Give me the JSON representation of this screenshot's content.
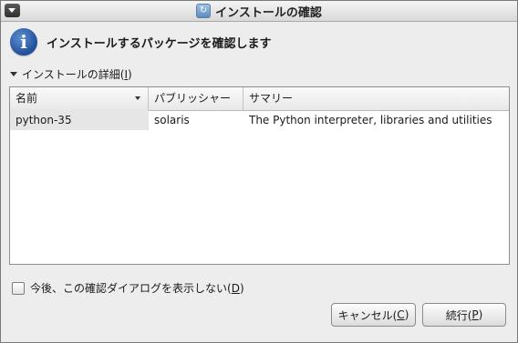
{
  "window": {
    "title": "インストールの確認"
  },
  "header": {
    "message": "インストールするパッケージを確認します"
  },
  "details": {
    "label": "インストールの詳細(",
    "mnemonic": "I",
    "label_end": ")"
  },
  "table": {
    "columns": [
      "名前",
      "パブリッシャー",
      "サマリー"
    ],
    "rows": [
      [
        "python-35",
        "solaris",
        "The Python interpreter, libraries and utilities"
      ]
    ]
  },
  "checkbox": {
    "label": "今後、この確認ダイアログを表示しない(",
    "mnemonic": "D",
    "label_end": ")",
    "checked": false
  },
  "buttons": {
    "cancel": {
      "label": "キャンセル(",
      "mnemonic": "C",
      "end": ")"
    },
    "continue": {
      "label": "続行(",
      "mnemonic": "P",
      "end": ")"
    }
  },
  "icons": {
    "window_icon": "package-manager-icon",
    "header_icon": "info-icon",
    "expander_icon": "expander-arrow-icon"
  }
}
